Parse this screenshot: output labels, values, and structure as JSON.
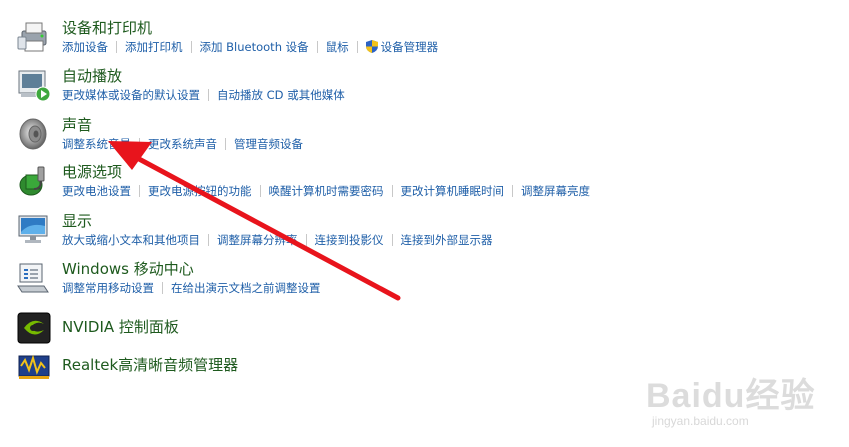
{
  "categories": [
    {
      "icon": "printer-icon",
      "title": "设备和打印机",
      "links": [
        {
          "label": "添加设备"
        },
        {
          "label": "添加打印机"
        },
        {
          "label": "添加 Bluetooth 设备"
        },
        {
          "label": "鼠标"
        },
        {
          "label": "设备管理器",
          "shield": true
        }
      ]
    },
    {
      "icon": "autoplay-icon",
      "title": "自动播放",
      "links": [
        {
          "label": "更改媒体或设备的默认设置"
        },
        {
          "label": "自动播放 CD 或其他媒体"
        }
      ]
    },
    {
      "icon": "speaker-icon",
      "title": "声音",
      "links": [
        {
          "label": "调整系统音量"
        },
        {
          "label": "更改系统声音"
        },
        {
          "label": "管理音频设备"
        }
      ]
    },
    {
      "icon": "power-icon",
      "title": "电源选项",
      "links": [
        {
          "label": "更改电池设置"
        },
        {
          "label": "更改电源按钮的功能"
        },
        {
          "label": "唤醒计算机时需要密码"
        },
        {
          "label": "更改计算机睡眠时间"
        },
        {
          "label": "调整屏幕亮度"
        }
      ]
    },
    {
      "icon": "display-icon",
      "title": "显示",
      "links": [
        {
          "label": "放大或缩小文本和其他项目"
        },
        {
          "label": "调整屏幕分辨率"
        },
        {
          "label": "连接到投影仪"
        },
        {
          "label": "连接到外部显示器"
        }
      ]
    },
    {
      "icon": "mobility-center-icon",
      "title": "Windows 移动中心",
      "links": [
        {
          "label": "调整常用移动设置"
        },
        {
          "label": "在给出演示文档之前调整设置"
        }
      ]
    },
    {
      "icon": "nvidia-icon",
      "title": "NVIDIA 控制面板",
      "links": []
    },
    {
      "icon": "realtek-icon",
      "title": "Realtek高清晰音频管理器",
      "links": []
    }
  ],
  "annotation_color": "#e8141c",
  "watermark": {
    "text": "Baidu经验",
    "url": "jingyan.baidu.com"
  }
}
